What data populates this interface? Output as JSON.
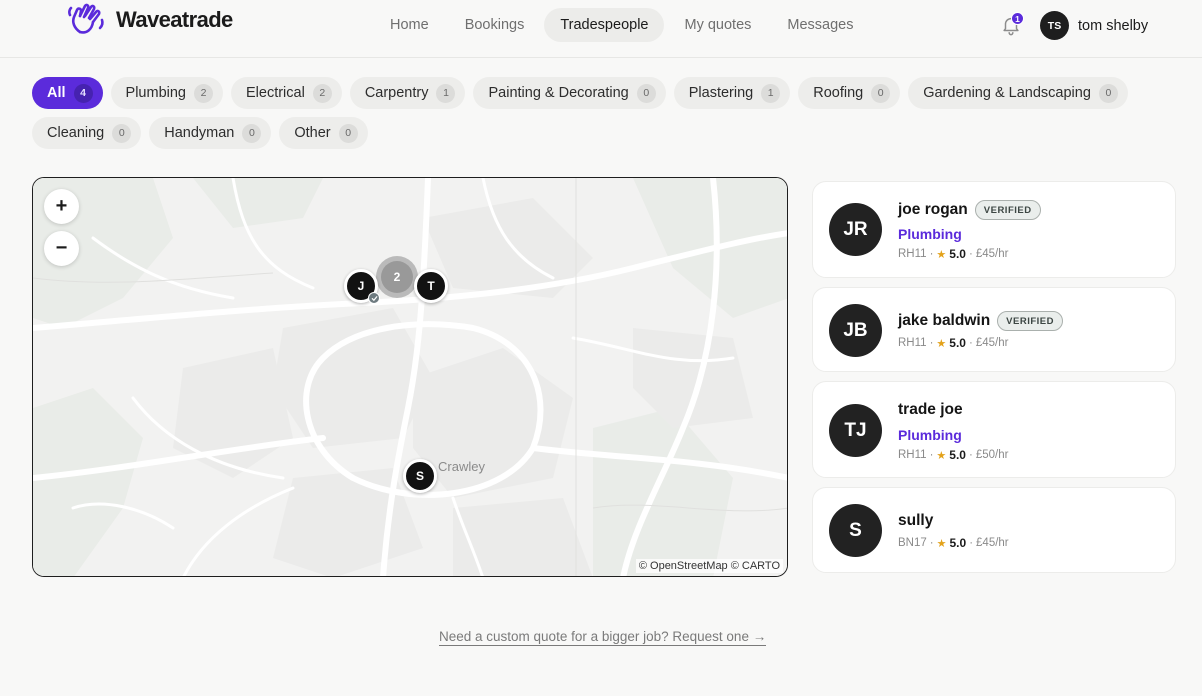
{
  "brand": {
    "name": "Waveatrade"
  },
  "nav": {
    "items": [
      {
        "label": "Home"
      },
      {
        "label": "Bookings"
      },
      {
        "label": "Tradespeople"
      },
      {
        "label": "My quotes"
      },
      {
        "label": "Messages"
      }
    ],
    "active": "Tradespeople"
  },
  "notifications": {
    "count": "1"
  },
  "user": {
    "initials": "TS",
    "name": "tom shelby"
  },
  "filters": [
    {
      "label": "All",
      "count": "4"
    },
    {
      "label": "Plumbing",
      "count": "2"
    },
    {
      "label": "Electrical",
      "count": "2"
    },
    {
      "label": "Carpentry",
      "count": "1"
    },
    {
      "label": "Painting & Decorating",
      "count": "0"
    },
    {
      "label": "Plastering",
      "count": "1"
    },
    {
      "label": "Roofing",
      "count": "0"
    },
    {
      "label": "Gardening & Landscaping",
      "count": "0"
    },
    {
      "label": "Cleaning",
      "count": "0"
    },
    {
      "label": "Handyman",
      "count": "0"
    },
    {
      "label": "Other",
      "count": "0"
    }
  ],
  "map": {
    "zoom_in": "+",
    "zoom_out": "−",
    "markers": [
      {
        "label": "J"
      },
      {
        "label": "T"
      },
      {
        "label": "S"
      }
    ],
    "cluster": {
      "label": "2"
    },
    "place_label": "Crawley",
    "attribution": "© OpenStreetMap © CARTO"
  },
  "tradespeople": [
    {
      "initials": "JR",
      "name": "joe rogan",
      "verified": "VERIFIED",
      "trade": "Plumbing",
      "postcode": "RH11",
      "rating": "5.0",
      "rate": "£45/hr"
    },
    {
      "initials": "JB",
      "name": "jake baldwin",
      "verified": "VERIFIED",
      "trade": "",
      "postcode": "RH11",
      "rating": "5.0",
      "rate": "£45/hr"
    },
    {
      "initials": "TJ",
      "name": "trade joe",
      "verified": "",
      "trade": "Plumbing",
      "postcode": "RH11",
      "rating": "5.0",
      "rate": "£50/hr"
    },
    {
      "initials": "S",
      "name": "sully",
      "verified": "",
      "trade": "",
      "postcode": "BN17",
      "rating": "5.0",
      "rate": "£45/hr"
    }
  ],
  "meta_separator": "·",
  "cta": {
    "label": "Need a custom quote for a bigger job? Request one →"
  },
  "colors": {
    "accent": "#5b2bdb",
    "marker": "#121212"
  }
}
